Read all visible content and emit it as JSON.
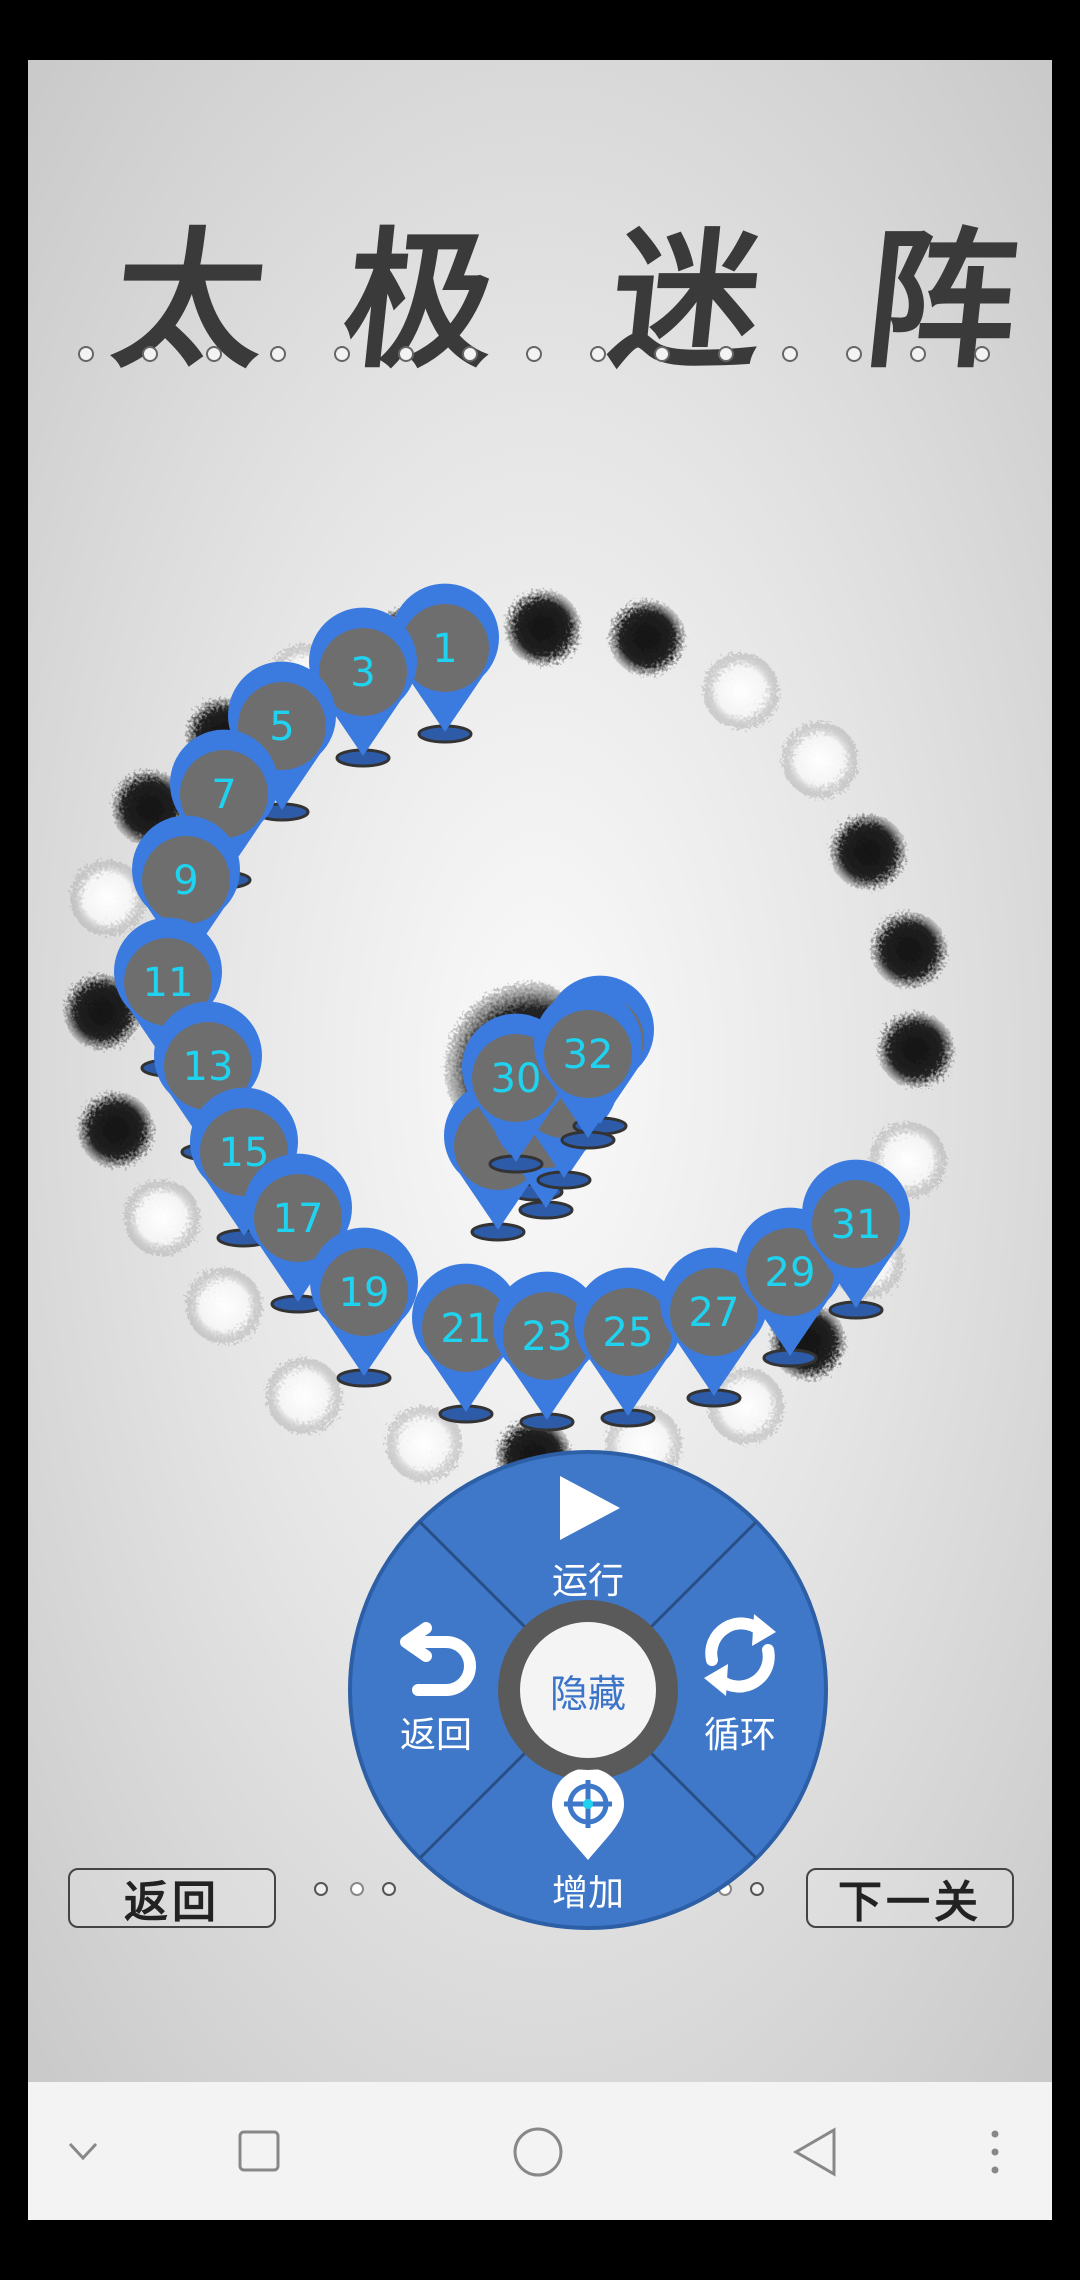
{
  "title": {
    "chars": [
      "太",
      "极",
      "迷",
      "阵"
    ]
  },
  "markers": [
    {
      "n": "1"
    },
    {
      "n": "3"
    },
    {
      "n": "5"
    },
    {
      "n": "7"
    },
    {
      "n": "9"
    },
    {
      "n": "11"
    },
    {
      "n": "13"
    },
    {
      "n": "15"
    },
    {
      "n": "17"
    },
    {
      "n": "19"
    },
    {
      "n": "21"
    },
    {
      "n": "23"
    },
    {
      "n": "25"
    },
    {
      "n": "27"
    },
    {
      "n": "29"
    },
    {
      "n": "31"
    },
    {
      "n": "30"
    },
    {
      "n": "32"
    }
  ],
  "radial_menu": {
    "run_label": "运行",
    "back_label": "返回",
    "loop_label": "循环",
    "add_label": "增加",
    "hide_label": "隐藏"
  },
  "footer": {
    "back_button": "返回",
    "next_button": "下一关"
  },
  "colors": {
    "marker_blue": "#3b7be0",
    "marker_center": "#6e6e6e",
    "marker_text": "#1fd3f0",
    "menu_blue": "#3f78c8"
  },
  "icons": {
    "run": "play-icon",
    "back": "undo-icon",
    "loop": "loop-icon",
    "add": "target-pin-icon"
  }
}
